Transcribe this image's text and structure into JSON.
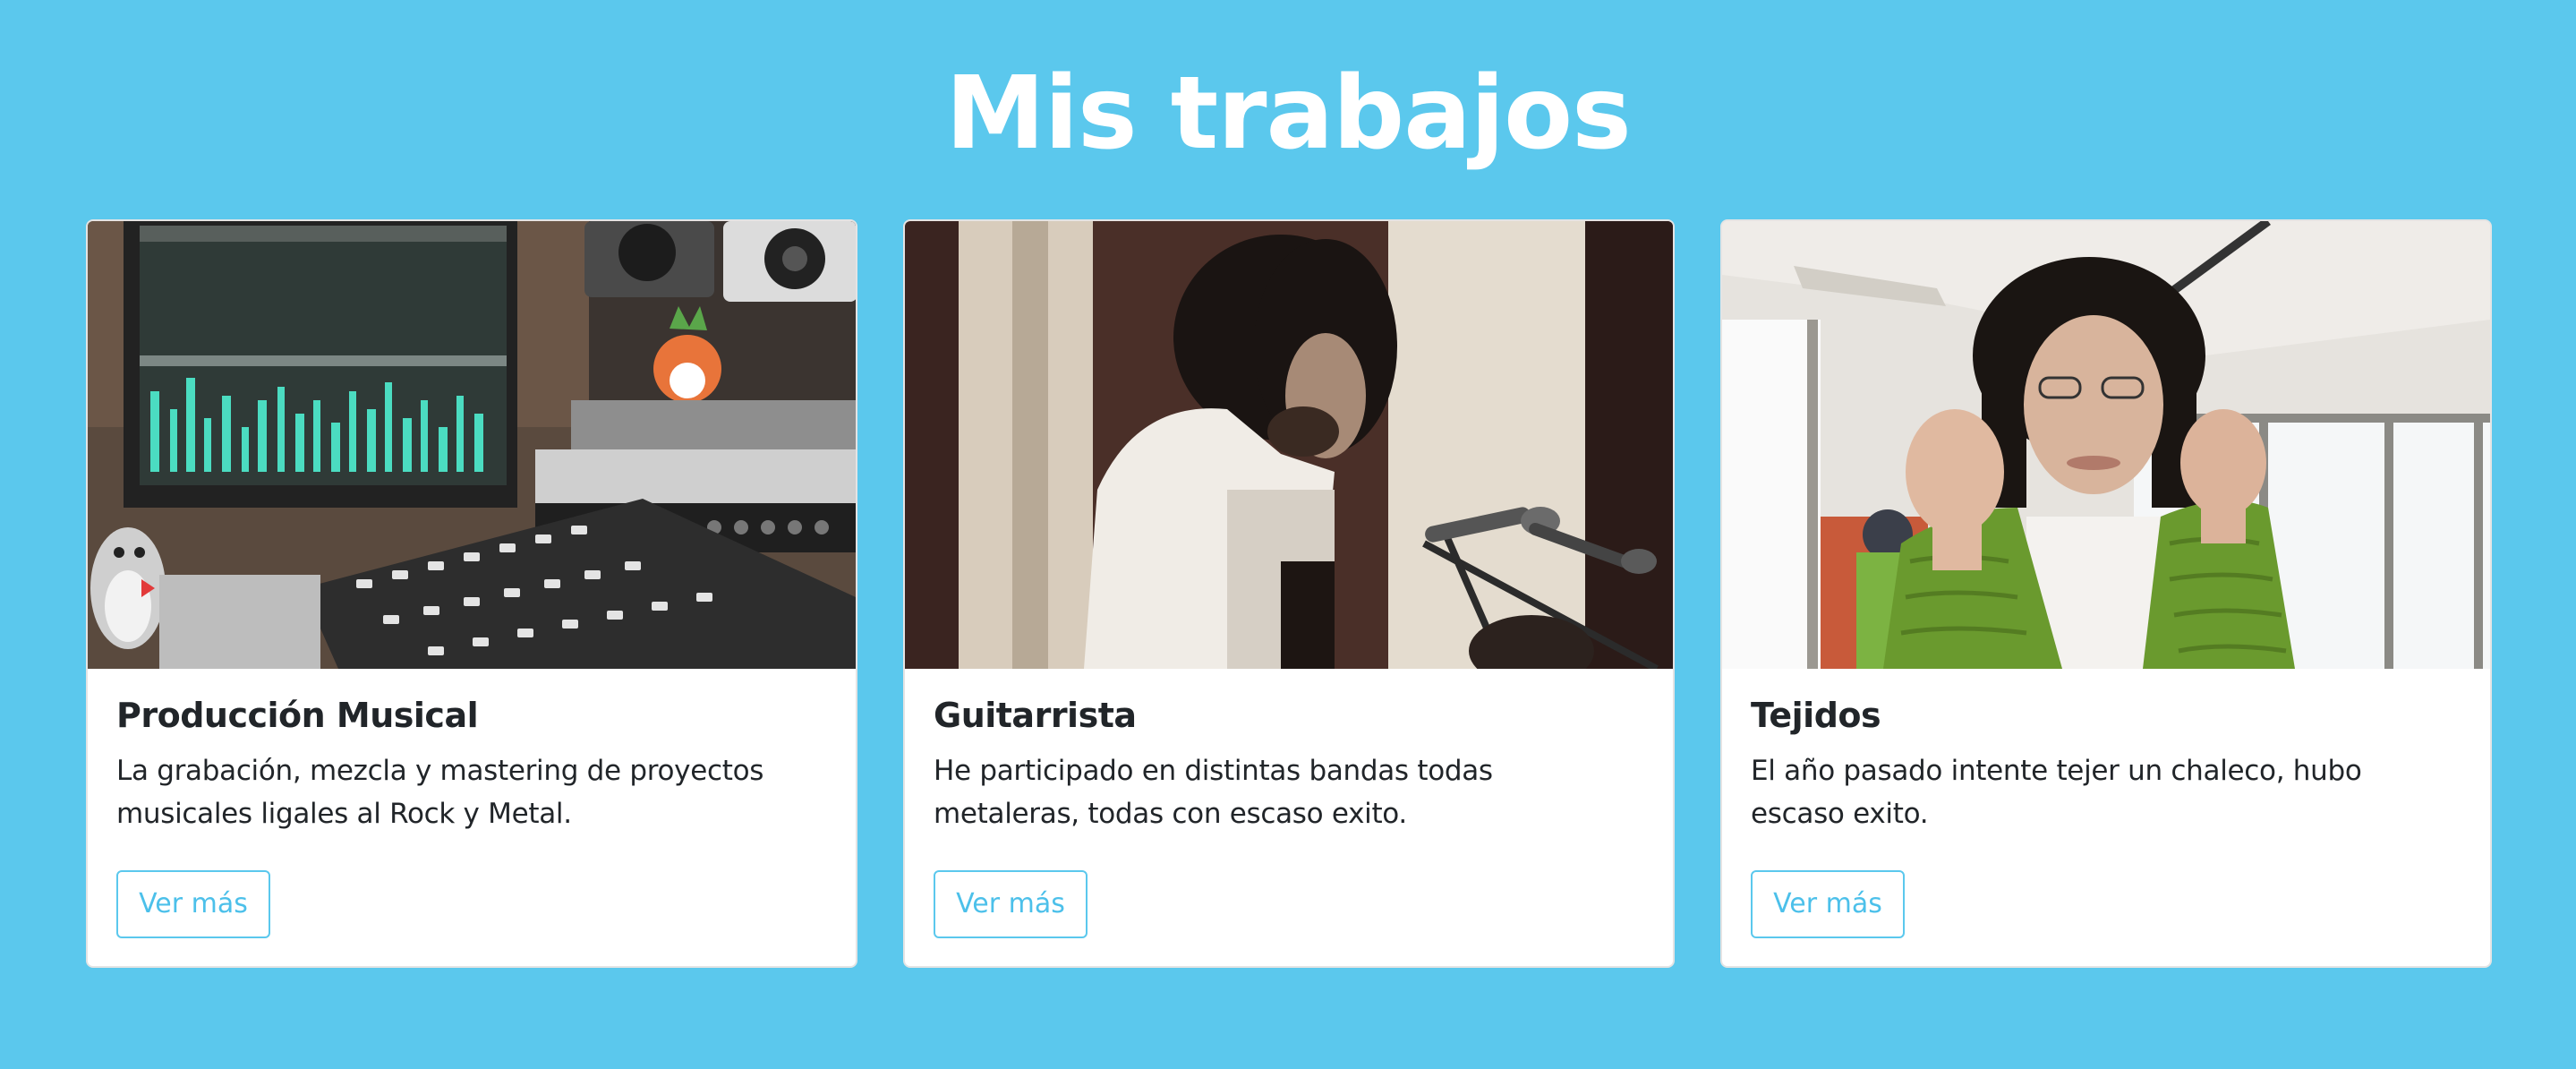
{
  "section": {
    "title": "Mis trabajos"
  },
  "cards": [
    {
      "title": "Producción Musical",
      "text": "La grabación, mezcla y mastering de proyectos musicales ligales al Rock y Metal.",
      "button_label": "Ver más",
      "image_subject": "studio-mixing-console"
    },
    {
      "title": "Guitarrista",
      "text": "He participado en distintas bandas todas metaleras, todas con escaso exito.",
      "button_label": "Ver más",
      "image_subject": "guitarist-with-microphone"
    },
    {
      "title": "Tejidos",
      "text": "El año pasado intente tejer un chaleco, hubo escaso exito.",
      "button_label": "Ver más",
      "image_subject": "person-wearing-knitted-vest"
    }
  ],
  "colors": {
    "background": "#5bc8ed",
    "accent": "#4cc0ea",
    "card": "#ffffff",
    "text": "#212529"
  }
}
